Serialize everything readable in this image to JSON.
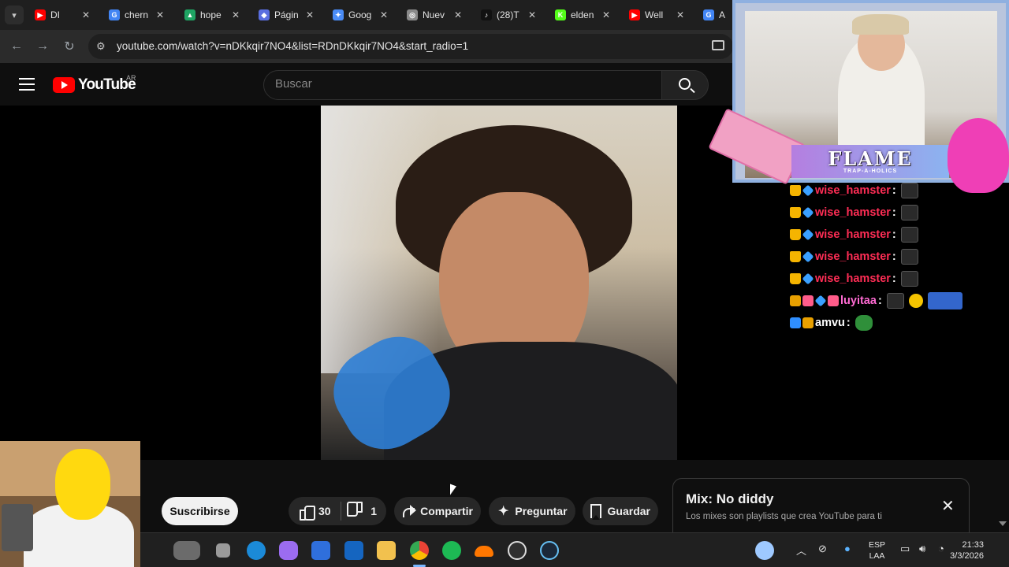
{
  "browser": {
    "tabs": [
      {
        "label": "DI",
        "favicon_color": "#ff0000",
        "favicon_glyph": "▶"
      },
      {
        "label": "chern",
        "favicon_color": "#4285f4",
        "favicon_glyph": "G"
      },
      {
        "label": "hope",
        "favicon_color": "#1fa463",
        "favicon_glyph": "▲"
      },
      {
        "label": "Págin",
        "favicon_color": "#5a6ee0",
        "favicon_glyph": "◆"
      },
      {
        "label": "Goog",
        "favicon_color": "#4a8cf7",
        "favicon_glyph": "✦"
      },
      {
        "label": "Nuev",
        "favicon_color": "#8a8a8a",
        "favicon_glyph": "◎"
      },
      {
        "label": "(28)T",
        "favicon_color": "#111111",
        "favicon_glyph": "♪"
      },
      {
        "label": "elden",
        "favicon_color": "#53fc18",
        "favicon_glyph": "K"
      },
      {
        "label": "Well",
        "favicon_color": "#ff0000",
        "favicon_glyph": "▶"
      },
      {
        "label": "Ay",
        "favicon_color": "#4285f4",
        "favicon_glyph": "G"
      }
    ],
    "tab_close_glyph": "✕",
    "url": "youtube.com/watch?v=nDKkqir7NO4&list=RDnDKkqir7NO4&start_radio=1"
  },
  "youtube": {
    "logo_text": "YouTube",
    "country_code": "AR",
    "search_placeholder": "Buscar",
    "actions": {
      "subscribe": "Suscribirse",
      "likes": "30",
      "dislikes": "1",
      "share": "Compartir",
      "ask": "Preguntar",
      "save": "Guardar"
    },
    "mix": {
      "title": "Mix: No diddy",
      "description": "Los mixes son playlists que crea YouTube para ti"
    }
  },
  "overlay": {
    "banner_title": "FLAME",
    "banner_subtitle": "TRAP-A-HOLICS",
    "chat": [
      {
        "user": "wise_hamster",
        "badges": [
          "crown",
          "gem"
        ],
        "emotes": [
          "mute"
        ]
      },
      {
        "user": "wise_hamster",
        "badges": [
          "crown",
          "gem"
        ],
        "emotes": [
          "mute"
        ]
      },
      {
        "user": "wise_hamster",
        "badges": [
          "crown",
          "gem"
        ],
        "emotes": [
          "mute"
        ]
      },
      {
        "user": "wise_hamster",
        "badges": [
          "crown",
          "gem"
        ],
        "emotes": [
          "mute"
        ]
      },
      {
        "user": "wise_hamster",
        "badges": [
          "crown",
          "gem"
        ],
        "emotes": [
          "mute"
        ]
      },
      {
        "user": "luyitaa",
        "badges": [
          "tile",
          "misc",
          "gem",
          "misc"
        ],
        "emotes": [
          "mute",
          "hand",
          "pic"
        ]
      },
      {
        "user": "amvu",
        "badges": [
          "pin",
          "tile"
        ],
        "emotes": [
          "frog"
        ]
      }
    ]
  },
  "taskbar": {
    "language_line1": "ESP",
    "language_line2": "LAA",
    "time": "21:33",
    "date": "3/3/2026",
    "apps": [
      "widgets-app",
      "task-view",
      "edge-browser",
      "copilot",
      "microsoft-store",
      "outlook",
      "file-explorer",
      "chrome-browser",
      "spotify",
      "soundcloud",
      "obs-studio",
      "steam"
    ]
  },
  "colors": {
    "youtube_red": "#ff0000",
    "chat_username": "#ff2d55",
    "page_bg": "#0f0f0f"
  }
}
